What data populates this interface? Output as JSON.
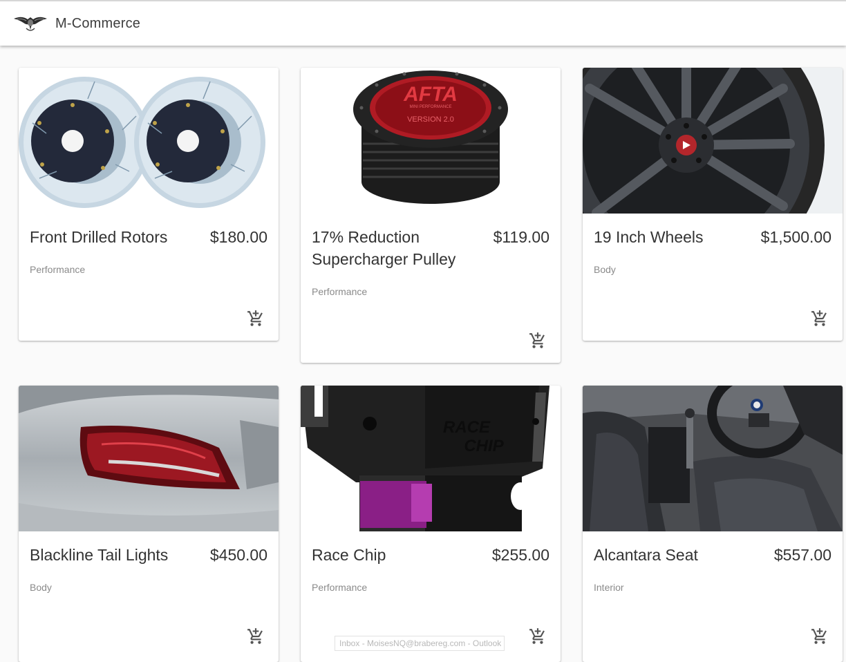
{
  "app": {
    "title": "M-Commerce",
    "logo_icon": "eagle-emblem-icon"
  },
  "products": [
    {
      "name": "Front Drilled Rotors",
      "price": "$180.00",
      "category": "Performance",
      "image": "brake-rotors-image"
    },
    {
      "name": "17% Reduction Supercharger Pulley",
      "price": "$119.00",
      "category": "Performance",
      "image": "supercharger-pulley-image"
    },
    {
      "name": "19 Inch Wheels",
      "price": "$1,500.00",
      "category": "Body",
      "image": "wheel-image"
    },
    {
      "name": "Blackline Tail Lights",
      "price": "$450.00",
      "category": "Body",
      "image": "tail-light-image"
    },
    {
      "name": "Race Chip",
      "price": "$255.00",
      "category": "Performance",
      "image": "race-chip-image"
    },
    {
      "name": "Alcantara Seat",
      "price": "$557.00",
      "category": "Interior",
      "image": "car-interior-image"
    }
  ],
  "product_images": {
    "pulley_brand": "AFTA",
    "pulley_text": "MINI PERFORMANCE",
    "pulley_version": "VERSION 2.0",
    "chip_brand_1": "RACE",
    "chip_brand_2": "CHIP"
  },
  "cart_icon": "add-shopping-cart-icon",
  "taskbar_tooltip": "Inbox - MoisesNQ@brabereg.com - Outlook"
}
